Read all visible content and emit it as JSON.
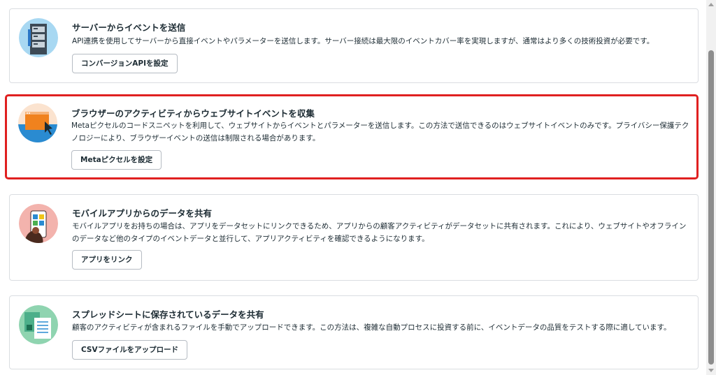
{
  "cards": [
    {
      "title": "サーバーからイベントを送信",
      "description": "API連携を使用してサーバーから直接イベントやパラメーターを送信します。サーバー接続は最大限のイベントカバー率を実現しますが、通常はより多くの技術投資が必要です。",
      "button": "コンバージョンAPIを設定"
    },
    {
      "title": "ブラウザーのアクティビティからウェブサイトイベントを収集",
      "description": "Metaピクセルのコードスニペットを利用して、ウェブサイトからイベントとパラメーターを送信します。この方法で送信できるのはウェブサイトイベントのみです。プライバシー保護テクノロジーにより、ブラウザーイベントの送信は制限される場合があります。",
      "button": "Metaピクセルを設定"
    },
    {
      "title": "モバイルアプリからのデータを共有",
      "description": "モバイルアプリをお持ちの場合は、アプリをデータセットにリンクできるため、アプリからの顧客アクティビティがデータセットに共有されます。これにより、ウェブサイトやオフラインのデータなど他のタイプのイベントデータと並行して、アプリアクティビティを確認できるようになります。",
      "button": "アプリをリンク"
    },
    {
      "title": "スプレッドシートに保存されているデータを共有",
      "description": "顧客のアクティビティが含まれるファイルを手動でアップロードできます。この方法は、複雑な自動プロセスに投資する前に、イベントデータの品質をテストする際に適しています。",
      "button": "CSVファイルをアップロード"
    }
  ],
  "colors": {
    "highlight": "#e02020",
    "border": "#dadde1",
    "text": "#1c2b33"
  },
  "icons": [
    "server-illustration-icon",
    "browser-pixel-illustration-icon",
    "mobile-app-illustration-icon",
    "spreadsheet-illustration-icon"
  ]
}
